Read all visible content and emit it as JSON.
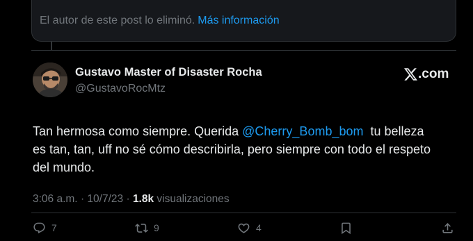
{
  "quoted_notice": {
    "text": "El autor de este post lo eliminó.",
    "link": "Más información"
  },
  "post": {
    "author_name": "Gustavo Master of Disaster Rocha",
    "author_handle": "@GustavoRocMtz",
    "source_label": ".com",
    "text_lines": [
      {
        "before": "Tan hermosa como siempre. Querida ",
        "mention": "@Cherry_Bomb_bom",
        "after": "  tu belleza"
      },
      "es tan, tan, uff no sé cómo describirla, pero siempre con todo el respeto",
      "del mundo."
    ],
    "time": "3:06 a.m.",
    "separator": "·",
    "date": "10/7/23",
    "views_count": "1.8k",
    "views_label": "visualizaciones"
  },
  "actions": {
    "reply_count": "7",
    "repost_count": "9",
    "like_count": "4"
  },
  "colors": {
    "background": "#000000",
    "text": "#e7e9ea",
    "secondary": "#71767b",
    "accent": "#1d9bf0",
    "border": "#2f3336"
  },
  "icons": [
    "x-logo-icon",
    "reply-icon",
    "repost-icon",
    "like-icon",
    "bookmark-icon",
    "share-icon"
  ]
}
